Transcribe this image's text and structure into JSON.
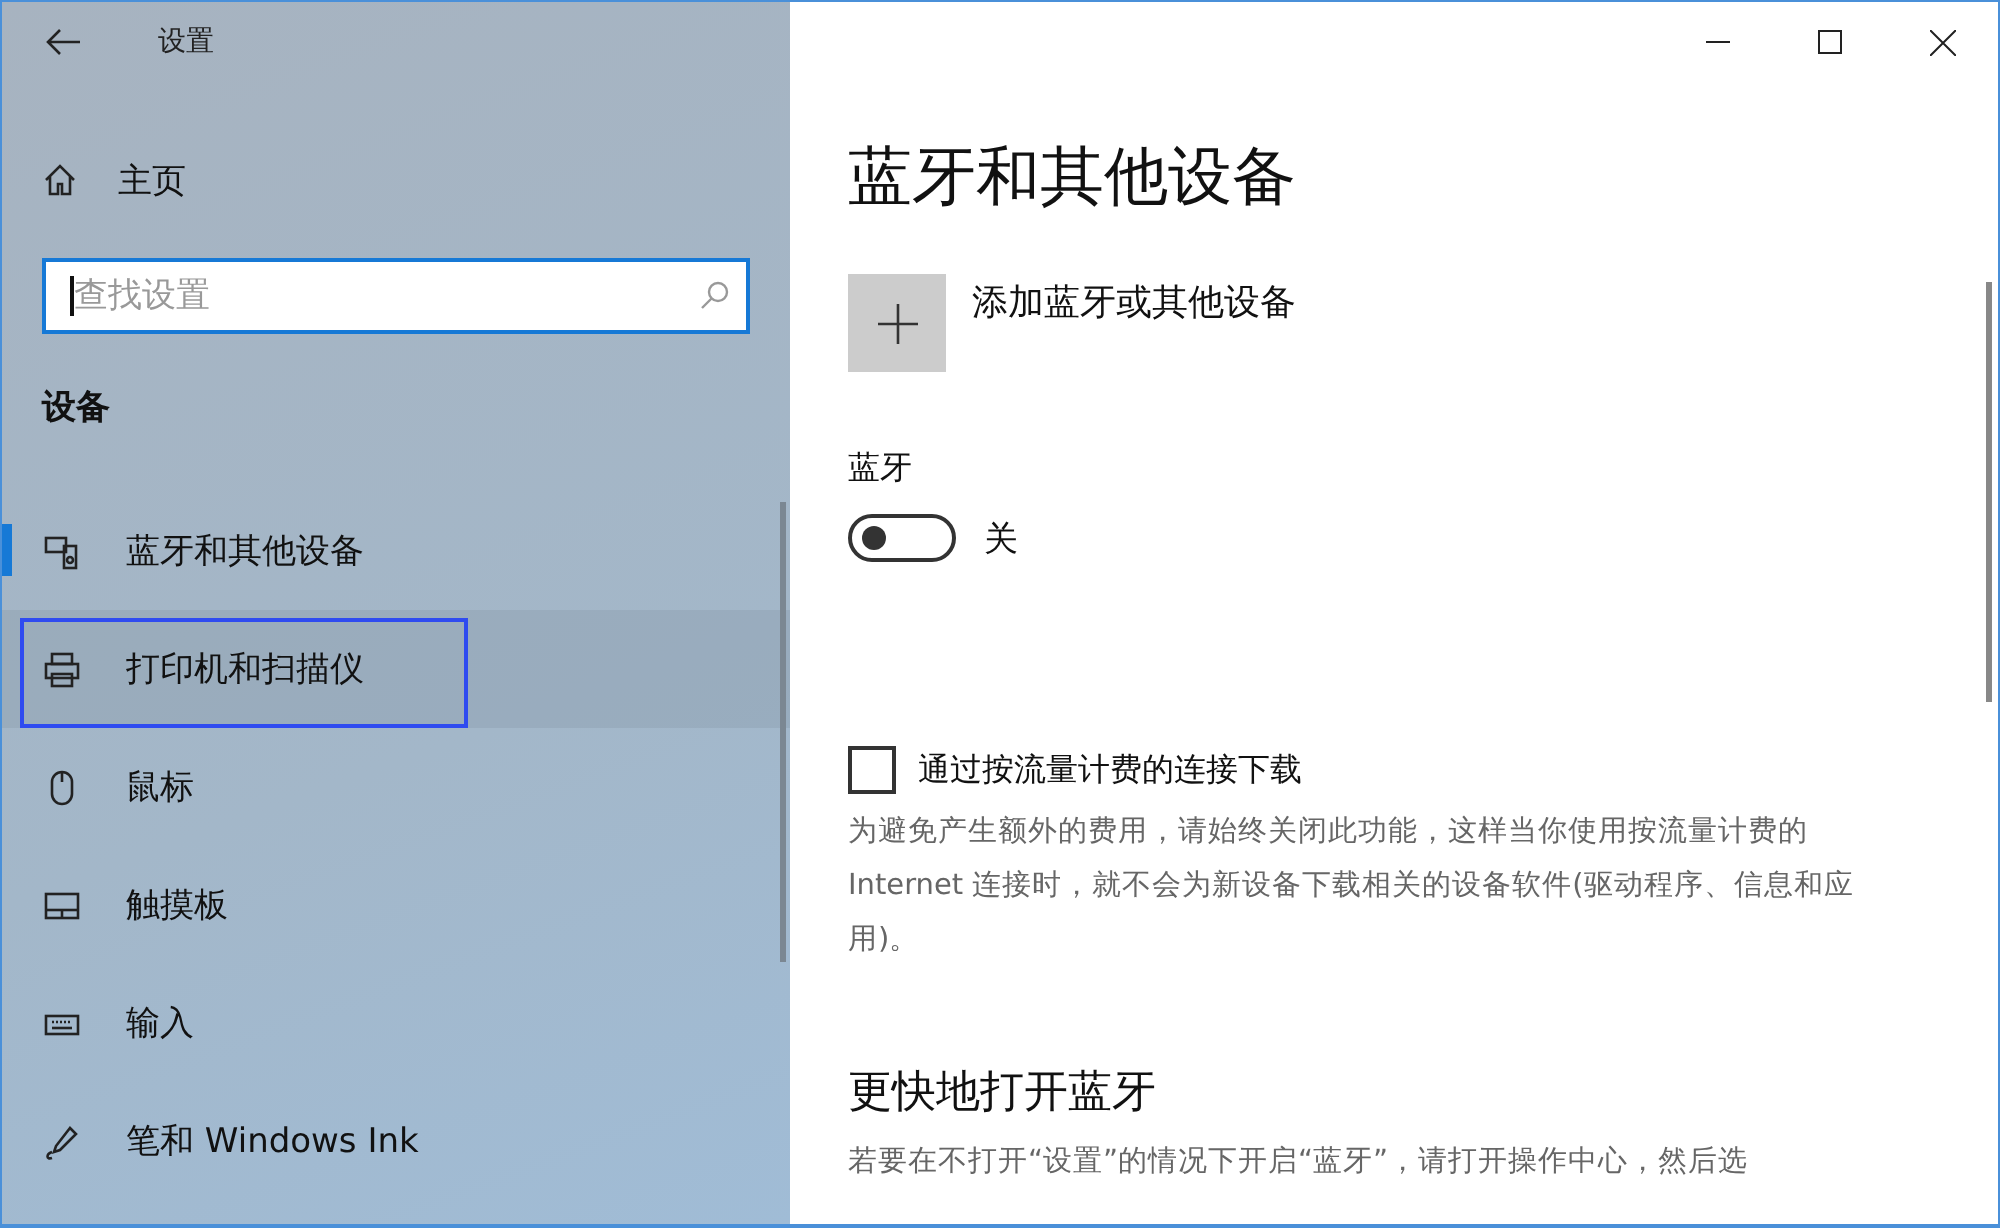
{
  "window": {
    "title": "设置"
  },
  "sidebar": {
    "home": "主页",
    "search": {
      "placeholder": "查找设置"
    },
    "section": "设备",
    "items": [
      {
        "kind": "bluetooth",
        "label": "蓝牙和其他设备",
        "selected": true,
        "highlighted": false
      },
      {
        "kind": "printer",
        "label": "打印机和扫描仪",
        "selected": false,
        "highlighted": true
      },
      {
        "kind": "mouse",
        "label": "鼠标",
        "selected": false,
        "highlighted": false
      },
      {
        "kind": "touchpad",
        "label": "触摸板",
        "selected": false,
        "highlighted": false
      },
      {
        "kind": "keyboard",
        "label": "输入",
        "selected": false,
        "highlighted": false
      },
      {
        "kind": "pen",
        "label": "笔和 Windows Ink",
        "selected": false,
        "highlighted": false
      }
    ]
  },
  "main": {
    "heading": "蓝牙和其他设备",
    "add_device": "添加蓝牙或其他设备",
    "bluetooth": {
      "label": "蓝牙",
      "on": false,
      "state_text": "关"
    },
    "metered": {
      "label": "通过按流量计费的连接下载",
      "checked": false,
      "description": "为避免产生额外的费用，请始终关闭此功能，这样当你使用按流量计费的 Internet 连接时，就不会为新设备下载相关的设备软件(驱动程序、信息和应用)。"
    },
    "quick": {
      "heading": "更快地打开蓝牙",
      "description": "若要在不打开“设置”的情况下开启“蓝牙”，请打开操作中心，然后选"
    }
  }
}
